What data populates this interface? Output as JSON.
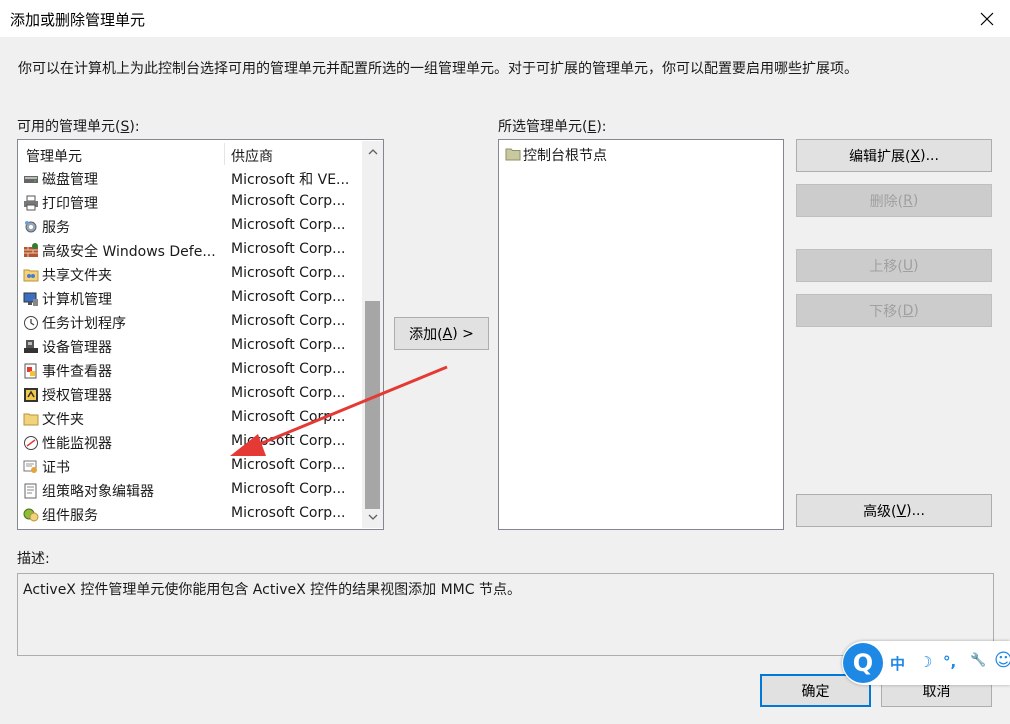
{
  "window": {
    "title": "添加或删除管理单元",
    "close_glyph": "✕"
  },
  "intro_text": "你可以在计算机上为此控制台选择可用的管理单元并配置所选的一组管理单元。对于可扩展的管理单元，你可以配置要启用哪些扩展项。",
  "available": {
    "label_prefix": "可用的管理单元(",
    "label_key": "S",
    "label_suffix": "):",
    "col_name": "管理单元",
    "col_vendor": "供应商",
    "items": [
      {
        "name": "磁盘管理",
        "vendor": "Microsoft 和 VE...",
        "icon": "disk-management-icon"
      },
      {
        "name": "打印管理",
        "vendor": "Microsoft Corp...",
        "icon": "printer-icon"
      },
      {
        "name": "服务",
        "vendor": "Microsoft Corp...",
        "icon": "gear-icon"
      },
      {
        "name": "高级安全 Windows Defe...",
        "vendor": "Microsoft Corp...",
        "icon": "firewall-icon"
      },
      {
        "name": "共享文件夹",
        "vendor": "Microsoft Corp...",
        "icon": "shared-folder-icon"
      },
      {
        "name": "计算机管理",
        "vendor": "Microsoft Corp...",
        "icon": "computer-management-icon"
      },
      {
        "name": "任务计划程序",
        "vendor": "Microsoft Corp...",
        "icon": "clock-icon"
      },
      {
        "name": "设备管理器",
        "vendor": "Microsoft Corp...",
        "icon": "device-manager-icon"
      },
      {
        "name": "事件查看器",
        "vendor": "Microsoft Corp...",
        "icon": "event-viewer-icon"
      },
      {
        "name": "授权管理器",
        "vendor": "Microsoft Corp...",
        "icon": "authorization-icon"
      },
      {
        "name": "文件夹",
        "vendor": "Microsoft Corp...",
        "icon": "folder-icon"
      },
      {
        "name": "性能监视器",
        "vendor": "Microsoft Corp...",
        "icon": "performance-monitor-icon"
      },
      {
        "name": "证书",
        "vendor": "Microsoft Corp...",
        "icon": "certificate-icon"
      },
      {
        "name": "组策略对象编辑器",
        "vendor": "Microsoft Corp...",
        "icon": "group-policy-icon"
      },
      {
        "name": "组件服务",
        "vendor": "Microsoft Corp...",
        "icon": "component-services-icon"
      }
    ]
  },
  "add_button": {
    "prefix": "添加(",
    "key": "A",
    "suffix": ") >"
  },
  "selected": {
    "label_prefix": "所选管理单元(",
    "label_key": "E",
    "label_suffix": "):",
    "root_item": "控制台根节点"
  },
  "side_buttons": {
    "edit_ext": {
      "prefix": "编辑扩展(",
      "key": "X",
      "suffix": ")..."
    },
    "remove": {
      "prefix": "删除(",
      "key": "R",
      "suffix": ")"
    },
    "move_up": {
      "prefix": "上移(",
      "key": "U",
      "suffix": ")"
    },
    "move_down": {
      "prefix": "下移(",
      "key": "D",
      "suffix": ")"
    },
    "advanced": {
      "prefix": "高级(",
      "key": "V",
      "suffix": ")..."
    }
  },
  "description": {
    "label": "描述:",
    "text": "ActiveX 控件管理单元使你能用包含 ActiveX 控件的结果视图添加 MMC 节点。"
  },
  "footer": {
    "ok": "确定",
    "cancel": "取消"
  },
  "ime": {
    "logo": "Q",
    "lang": "中",
    "moon": "☽",
    "punct": "°,",
    "wrench": "🔧",
    "smile": "☺"
  },
  "colors": {
    "accent": "#0078d7",
    "arrow": "#e53935"
  }
}
